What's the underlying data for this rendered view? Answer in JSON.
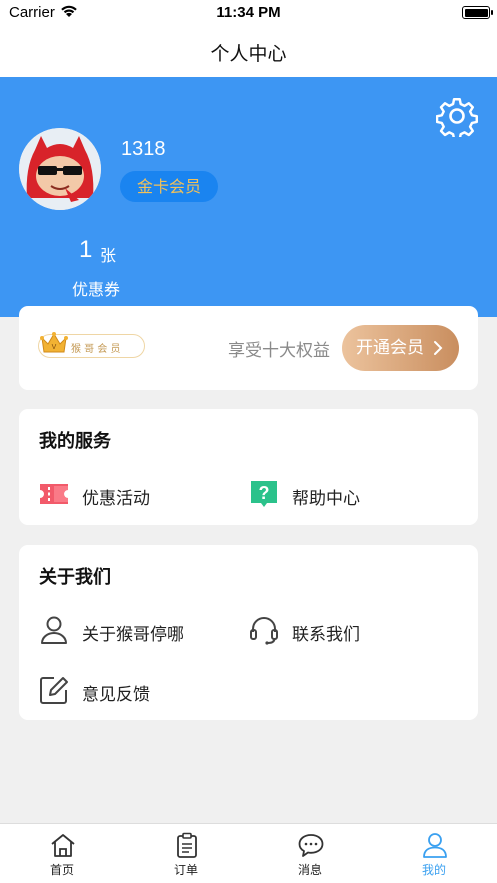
{
  "status_bar": {
    "carrier": "Carrier",
    "time": "11:34 PM"
  },
  "nav": {
    "title": "个人中心"
  },
  "profile": {
    "username": "1318",
    "member_level": "金卡会员",
    "coupon_count": "1",
    "coupon_unit": "张",
    "coupon_label": "优惠券"
  },
  "vip": {
    "badge_text": "猴 哥 会 员",
    "tagline": "享受十大权益",
    "button_label": "开通会员"
  },
  "services": {
    "title": "我的服务",
    "items": [
      {
        "label": "优惠活动",
        "icon": "coupon-ticket-icon"
      },
      {
        "label": "帮助中心",
        "icon": "help-question-icon"
      }
    ]
  },
  "about": {
    "title": "关于我们",
    "items": [
      {
        "label": "关于猴哥停哪",
        "icon": "user-icon"
      },
      {
        "label": "联系我们",
        "icon": "headset-icon"
      },
      {
        "label": "意见反馈",
        "icon": "edit-icon"
      }
    ]
  },
  "tabs": [
    {
      "label": "首页",
      "icon": "home-icon"
    },
    {
      "label": "订单",
      "icon": "order-clipboard-icon"
    },
    {
      "label": "消息",
      "icon": "message-bubble-icon"
    },
    {
      "label": "我的",
      "icon": "profile-icon",
      "active": true
    }
  ],
  "colors": {
    "header_blue": "#3d96f3",
    "tab_active": "#3aa0f0",
    "gold": "#f1c15a"
  }
}
